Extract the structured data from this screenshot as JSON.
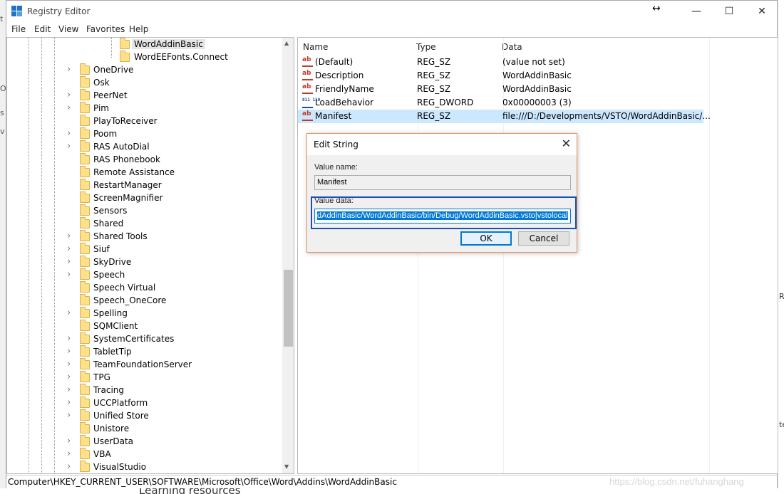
{
  "window": {
    "title": "Registry Editor",
    "resize_glyph": "↔",
    "minimize": "—",
    "maximize": "☐",
    "close": "✕"
  },
  "menu": [
    "File",
    "Edit",
    "View",
    "Favorites",
    "Help"
  ],
  "tree": {
    "nested_items": [
      "WordAddinBasic",
      "WordEEFonts.Connect"
    ],
    "items": [
      {
        "label": "OneDrive",
        "expandable": true
      },
      {
        "label": "Osk",
        "expandable": false
      },
      {
        "label": "PeerNet",
        "expandable": true
      },
      {
        "label": "Pim",
        "expandable": true
      },
      {
        "label": "PlayToReceiver",
        "expandable": false
      },
      {
        "label": "Poom",
        "expandable": true
      },
      {
        "label": "RAS AutoDial",
        "expandable": true
      },
      {
        "label": "RAS Phonebook",
        "expandable": false
      },
      {
        "label": "Remote Assistance",
        "expandable": false
      },
      {
        "label": "RestartManager",
        "expandable": false
      },
      {
        "label": "ScreenMagnifier",
        "expandable": false
      },
      {
        "label": "Sensors",
        "expandable": false
      },
      {
        "label": "Shared",
        "expandable": false
      },
      {
        "label": "Shared Tools",
        "expandable": true
      },
      {
        "label": "Siuf",
        "expandable": true
      },
      {
        "label": "SkyDrive",
        "expandable": true
      },
      {
        "label": "Speech",
        "expandable": true
      },
      {
        "label": "Speech Virtual",
        "expandable": false
      },
      {
        "label": "Speech_OneCore",
        "expandable": false
      },
      {
        "label": "Spelling",
        "expandable": true
      },
      {
        "label": "SQMClient",
        "expandable": false
      },
      {
        "label": "SystemCertificates",
        "expandable": true
      },
      {
        "label": "TabletTip",
        "expandable": true
      },
      {
        "label": "TeamFoundationServer",
        "expandable": true
      },
      {
        "label": "TPG",
        "expandable": true
      },
      {
        "label": "Tracing",
        "expandable": true
      },
      {
        "label": "UCCPlatform",
        "expandable": true
      },
      {
        "label": "Unified Store",
        "expandable": true
      },
      {
        "label": "Unistore",
        "expandable": false
      },
      {
        "label": "UserData",
        "expandable": true
      },
      {
        "label": "VBA",
        "expandable": true
      },
      {
        "label": "VisualStudio",
        "expandable": true
      }
    ]
  },
  "list": {
    "columns": [
      "Name",
      "Type",
      "Data"
    ],
    "rows": [
      {
        "name": "(Default)",
        "type": "REG_SZ",
        "data": "(value not set)",
        "icon": "string-value-icon"
      },
      {
        "name": "Description",
        "type": "REG_SZ",
        "data": "WordAddinBasic",
        "icon": "string-value-icon"
      },
      {
        "name": "FriendlyName",
        "type": "REG_SZ",
        "data": "WordAddinBasic",
        "icon": "string-value-icon"
      },
      {
        "name": "LoadBehavior",
        "type": "REG_DWORD",
        "data": "0x00000003 (3)",
        "icon": "dword-value-icon"
      },
      {
        "name": "Manifest",
        "type": "REG_SZ",
        "data": "file:///D:/Developments/VSTO/WordAddinBasic/...",
        "icon": "string-value-icon"
      }
    ]
  },
  "dialog": {
    "title": "Edit String",
    "value_name_label": "Value name:",
    "value_name": "Manifest",
    "value_data_label": "Value data:",
    "value_data": "dAddinBasic/WordAddinBasic/bin/Debug/WordAddinBasic.vsto|vstolocal",
    "ok": "OK",
    "cancel": "Cancel"
  },
  "statusbar": {
    "path": "Computer\\HKEY_CURRENT_USER\\SOFTWARE\\Microsoft\\Office\\Word\\Addins\\WordAddinBasic"
  },
  "background": {
    "bottom_text": "Learning resources",
    "watermark": "https://blog.csdn.net/fuhanghang"
  },
  "colors": {
    "selection": "#cce8ff",
    "accent": "#0078d7",
    "highlight_frame": "#1b4fb4",
    "dialog_border": "#e39660"
  }
}
